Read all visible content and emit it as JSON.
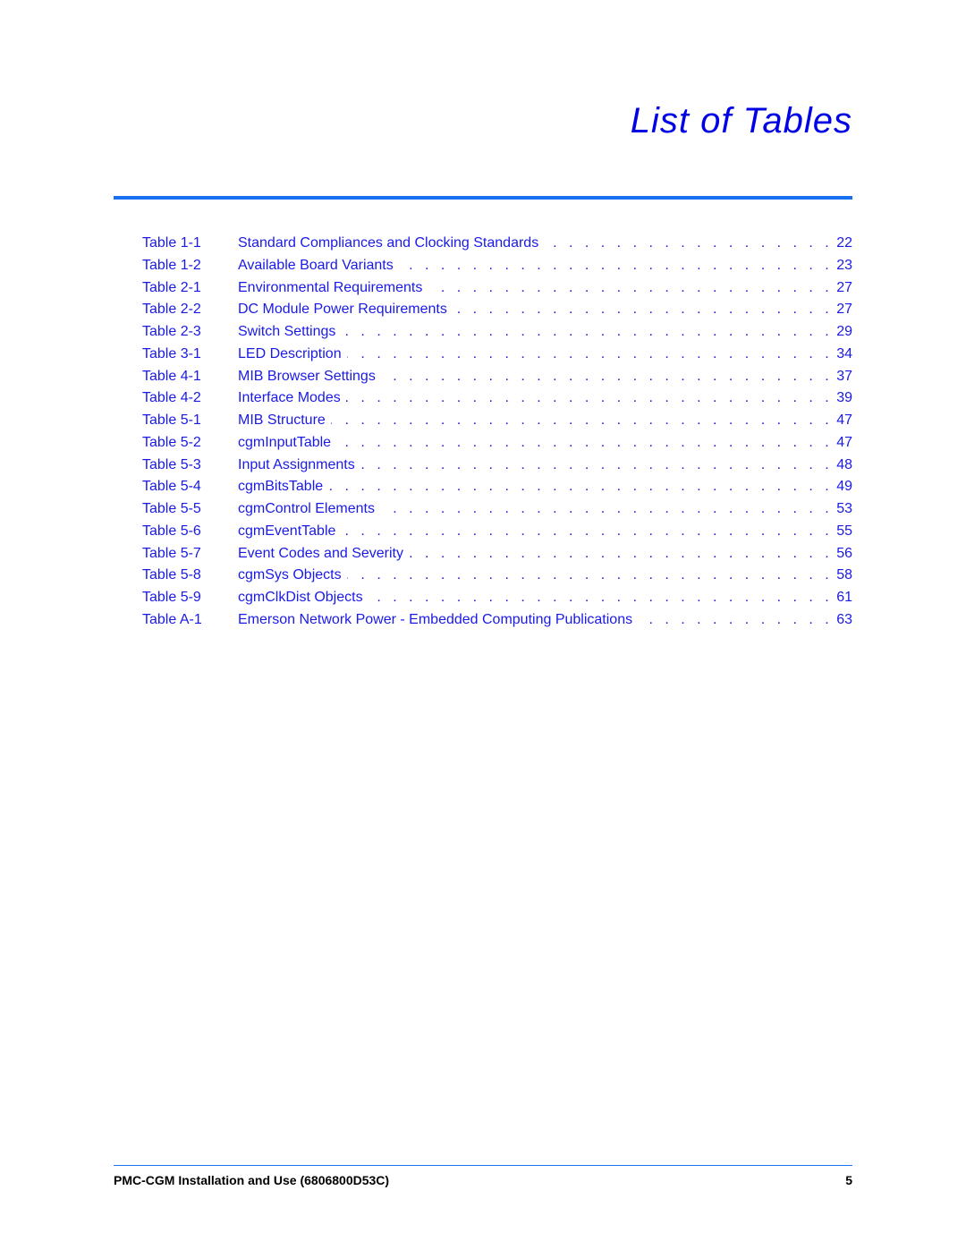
{
  "title": "List of Tables",
  "entries": [
    {
      "num": "Table 1-1",
      "name": "Standard Compliances and Clocking Standards",
      "page": "22"
    },
    {
      "num": "Table 1-2",
      "name": "Available Board Variants",
      "page": "23"
    },
    {
      "num": "Table 2-1",
      "name": "Environmental Requirements",
      "page": "27"
    },
    {
      "num": "Table 2-2",
      "name": "DC Module Power Requirements",
      "page": "27"
    },
    {
      "num": "Table 2-3",
      "name": "Switch Settings",
      "page": "29"
    },
    {
      "num": "Table 3-1",
      "name": "LED Description",
      "page": "34"
    },
    {
      "num": "Table 4-1",
      "name": "MIB Browser Settings",
      "page": "37"
    },
    {
      "num": "Table 4-2",
      "name": "Interface Modes",
      "page": "39"
    },
    {
      "num": "Table 5-1",
      "name": "MIB Structure",
      "page": "47"
    },
    {
      "num": "Table 5-2",
      "name": "cgmInputTable",
      "page": "47"
    },
    {
      "num": "Table 5-3",
      "name": "Input Assignments",
      "page": "48"
    },
    {
      "num": "Table 5-4",
      "name": "cgmBitsTable",
      "page": "49"
    },
    {
      "num": "Table 5-5",
      "name": "cgmControl Elements",
      "page": "53"
    },
    {
      "num": "Table 5-6",
      "name": "cgmEventTable",
      "page": "55"
    },
    {
      "num": "Table 5-7",
      "name": "Event Codes and Severity",
      "page": "56"
    },
    {
      "num": "Table 5-8",
      "name": "cgmSys Objects",
      "page": "58"
    },
    {
      "num": "Table 5-9",
      "name": "cgmClkDist Objects",
      "page": "61"
    },
    {
      "num": "Table A-1",
      "name": "Emerson Network Power - Embedded Computing Publications",
      "page": "63"
    }
  ],
  "leader": ". . . . . . . . . . . . . . . . . . . . . . . . . . . . . . . . . . . . . . . . . . . . . . . . . . . . . . . . . . . . . . . . . . . . .",
  "footer": {
    "document": "PMC-CGM Installation and Use (6806800D53C)",
    "page": "5"
  },
  "colors": {
    "title": "#0000e6",
    "links": "#1a1ae6",
    "rule": "#1a6ef0"
  }
}
